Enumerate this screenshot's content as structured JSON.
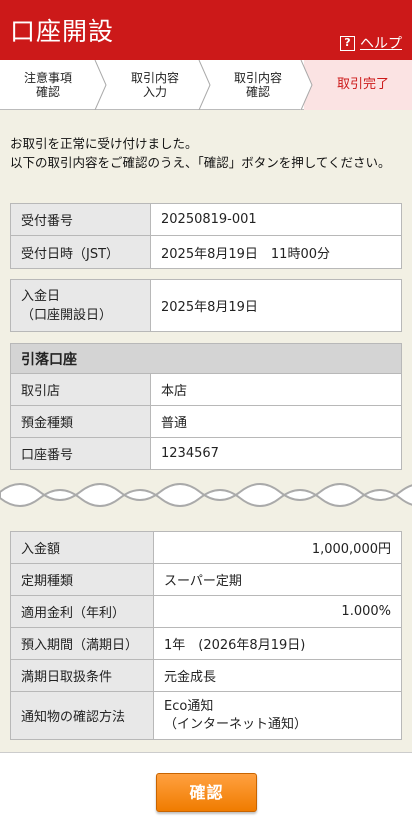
{
  "header": {
    "title": "口座開設",
    "help_label": "ヘルプ",
    "help_icon_char": "?"
  },
  "steps": [
    {
      "label_line1": "注意事項",
      "label_line2": "確認",
      "active": false
    },
    {
      "label_line1": "取引内容",
      "label_line2": "入力",
      "active": false
    },
    {
      "label_line1": "取引内容",
      "label_line2": "確認",
      "active": false
    },
    {
      "label_line1": "取引完了",
      "label_line2": "",
      "active": true
    }
  ],
  "notice": {
    "line1": "お取引を正常に受け付けました。",
    "line2": "以下の取引内容をご確認のうえ、「確認」ボタンを押してください。"
  },
  "reception": {
    "number_label": "受付番号",
    "number_value": "20250819-001",
    "datetime_label": "受付日時（JST）",
    "datetime_value": "2025年8月19日　11時00分"
  },
  "deposit_date": {
    "label_line1": "入金日",
    "label_line2": "（口座開設日）",
    "value": "2025年8月19日"
  },
  "debit_account": {
    "section_title": "引落口座",
    "branch_label": "取引店",
    "branch_value": "本店",
    "type_label": "預金種類",
    "type_value": "普通",
    "number_label": "口座番号",
    "number_value": "1234567"
  },
  "details": {
    "amount_label": "入金額",
    "amount_value": "1,000,000円",
    "kind_label": "定期種類",
    "kind_value": "スーパー定期",
    "rate_label": "適用金利（年利）",
    "rate_value": "1.000%",
    "period_label": "預入期間（満期日）",
    "period_value": "1年　(2026年8月19日)",
    "maturity_label": "満期日取扱条件",
    "maturity_value": "元金成長",
    "notify_label": "通知物の確認方法",
    "notify_value_line1": "Eco通知",
    "notify_value_line2": "（インターネット通知）"
  },
  "confirm_button": "確認",
  "colors": {
    "brand_red": "#cc1919",
    "active_step_bg": "#fbe3e3",
    "button_orange": "#f58a1f",
    "page_bg": "#f2f0e4"
  }
}
